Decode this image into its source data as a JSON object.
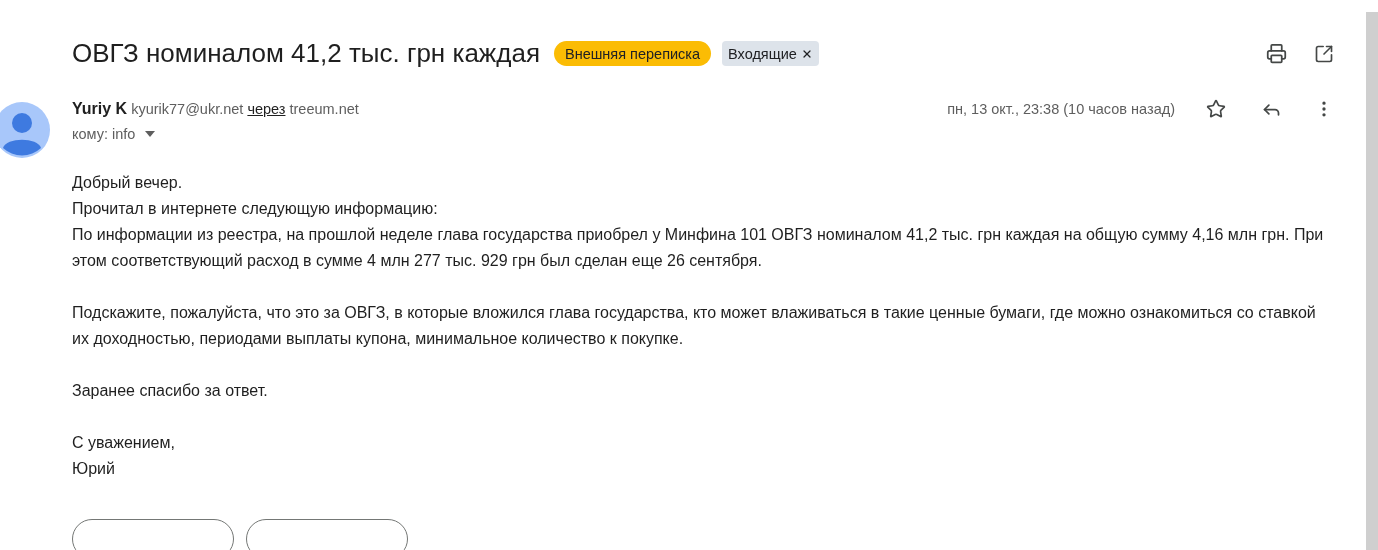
{
  "subject": "ОВГЗ номиналом 41,2 тыс. грн каждая",
  "labels": [
    {
      "text": "Внешняя переписка",
      "color": "#fbbc04",
      "removable": false
    },
    {
      "text": "Входящие",
      "color": "#dde3ea",
      "removable": true
    }
  ],
  "sender": {
    "name": "Yuriy K",
    "email": "kyurik77@ukr.net",
    "via_word": "через",
    "via_domain": "treeum.net",
    "to_line": "кому: info"
  },
  "date": "пн, 13 окт., 23:38 (10 часов назад)",
  "starred": false,
  "body": [
    [
      "Добрый вечер.",
      "Прочитал в интернете следующую информацию:",
      "По информации из реестра, на прошлой неделе глава государства приобрел у Минфина 101 ОВГЗ номиналом 41,2 тыс. грн каждая на общую сумму 4,16 млн грн. При этом соответствующий расход в сумме 4 млн 277 тыс. 929 грн был сделан еще 26 сентября."
    ],
    [
      "Подскажите, пожалуйста, что это за ОВГЗ, в которые вложился глава государства, кто может влаживаться в такие ценные бумаги, где можно ознакомиться со ставкой их доходностью, периодами выплаты купона, минимальное количество к покупке."
    ],
    [
      "Заранее спасибо за ответ."
    ],
    [
      "С уважением,",
      "Юрий"
    ]
  ],
  "action_buttons": [
    {
      "kind": "outlined"
    },
    {
      "kind": "outlined"
    }
  ]
}
